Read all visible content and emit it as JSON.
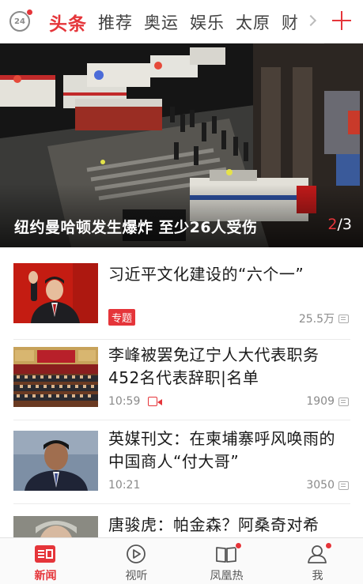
{
  "top_bar": {
    "clock_badge": "24",
    "tabs": [
      {
        "label": "头条",
        "active": true
      },
      {
        "label": "推荐",
        "active": false
      },
      {
        "label": "奥运",
        "active": false
      },
      {
        "label": "娱乐",
        "active": false
      },
      {
        "label": "太原",
        "active": false
      },
      {
        "label": "财",
        "active": false
      }
    ],
    "accent_color": "#e5353a"
  },
  "hero": {
    "title": "纽约曼哈顿发生爆炸 至少26人受伤",
    "pager_current": "2",
    "pager_total": "/3"
  },
  "news": [
    {
      "headline": "习近平文化建设的“六个一”",
      "tag": "专题",
      "time": "",
      "count": "25.5万",
      "video": false
    },
    {
      "headline": "李峰被罢免辽宁人大代表职务 452名代表辞职|名单",
      "tag": "",
      "time": "10:59",
      "count": "1909",
      "video": true
    },
    {
      "headline": "英媒刊文：在柬埔寨呼风唤雨的中国商人“付大哥”",
      "tag": "",
      "time": "10:21",
      "count": "3050",
      "video": false
    },
    {
      "headline": "唐骏虎：帕金森？阿桑奇对希",
      "tag": "",
      "time": "",
      "count": "",
      "video": false
    }
  ],
  "bottom_nav": [
    {
      "label": "新闻",
      "icon": "news-icon",
      "active": true,
      "dot": false
    },
    {
      "label": "视听",
      "icon": "play-icon",
      "active": false,
      "dot": false
    },
    {
      "label": "凤凰热",
      "icon": "book-icon",
      "active": false,
      "dot": true
    },
    {
      "label": "我",
      "icon": "user-icon",
      "active": false,
      "dot": true
    }
  ]
}
